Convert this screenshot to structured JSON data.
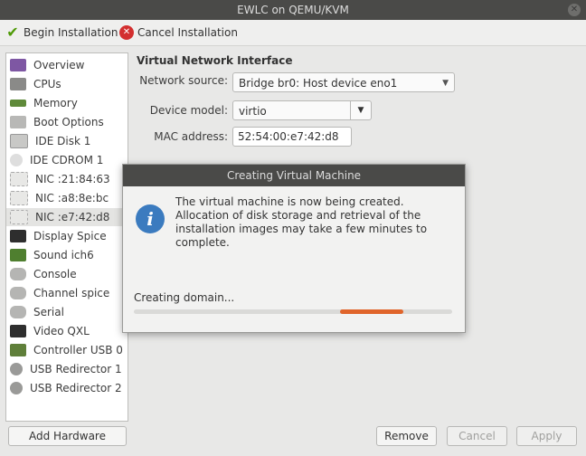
{
  "window": {
    "title": "EWLC on QEMU/KVM"
  },
  "toolbar": {
    "begin_label": "Begin Installation",
    "cancel_label": "Cancel Installation"
  },
  "sidebar": {
    "items": [
      {
        "label": "Overview",
        "icon": "overview-icon"
      },
      {
        "label": "CPUs",
        "icon": "cpu-icon"
      },
      {
        "label": "Memory",
        "icon": "memory-icon"
      },
      {
        "label": "Boot Options",
        "icon": "boot-options-icon"
      },
      {
        "label": "IDE Disk 1",
        "icon": "disk-icon"
      },
      {
        "label": "IDE CDROM 1",
        "icon": "cdrom-icon"
      },
      {
        "label": "NIC :21:84:63",
        "icon": "nic-icon"
      },
      {
        "label": "NIC :a8:8e:bc",
        "icon": "nic-icon"
      },
      {
        "label": "NIC :e7:42:d8",
        "icon": "nic-icon",
        "selected": true
      },
      {
        "label": "Display Spice",
        "icon": "display-icon"
      },
      {
        "label": "Sound ich6",
        "icon": "sound-icon"
      },
      {
        "label": "Console",
        "icon": "console-icon"
      },
      {
        "label": "Channel spice",
        "icon": "channel-icon"
      },
      {
        "label": "Serial",
        "icon": "serial-icon"
      },
      {
        "label": "Video QXL",
        "icon": "video-icon"
      },
      {
        "label": "Controller USB 0",
        "icon": "controller-icon"
      },
      {
        "label": "USB Redirector 1",
        "icon": "usb-icon"
      },
      {
        "label": "USB Redirector 2",
        "icon": "usb-icon"
      }
    ],
    "add_hardware_label": "Add Hardware"
  },
  "nic": {
    "section_title": "Virtual Network Interface",
    "network_source_label": "Network source:",
    "network_source_value": "Bridge br0: Host device eno1",
    "device_model_label": "Device model:",
    "device_model_value": "virtio",
    "mac_label": "MAC address:",
    "mac_value": "52:54:00:e7:42:d8"
  },
  "dialog": {
    "title": "Creating Virtual Machine",
    "message": "The virtual machine is now being created. Allocation of disk storage and retrieval of the installation images may take a few minutes to complete.",
    "status": "Creating domain..."
  },
  "footer": {
    "remove_label": "Remove",
    "cancel_label": "Cancel",
    "apply_label": "Apply"
  },
  "colors": {
    "accent": "#e0652b",
    "titlebar": "#4a4a48",
    "info": "#3b7bbf"
  }
}
